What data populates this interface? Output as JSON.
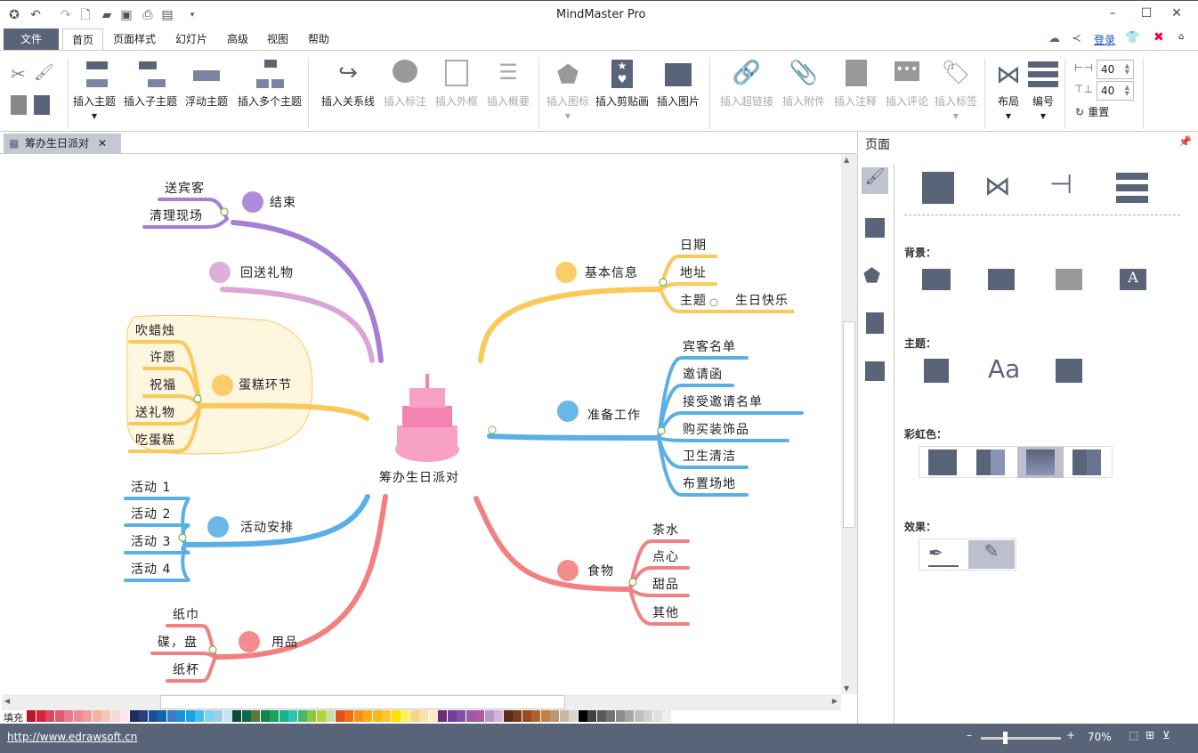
{
  "app": {
    "title": "MindMaster Pro"
  },
  "menu": {
    "file": "文件",
    "tabs": [
      "首页",
      "页面样式",
      "幻灯片",
      "高级",
      "视图",
      "帮助"
    ],
    "login": "登录"
  },
  "ribbon": {
    "insert_topic": "插入主题",
    "insert_subtopic": "插入子主题",
    "floating_topic": "浮动主题",
    "insert_multiple": "插入多个主题",
    "insert_relation": "插入关系线",
    "insert_callout": "插入标注",
    "insert_boundary": "插入外框",
    "insert_summary": "插入概要",
    "insert_icon": "插入图标",
    "insert_clipart": "插入剪贴画",
    "insert_image": "插入图片",
    "insert_hyperlink": "插入超链接",
    "insert_attachment": "插入附件",
    "insert_note": "插入注释",
    "insert_comment": "插入评论",
    "insert_tag": "插入标签",
    "layout": "布局",
    "numbering": "编号",
    "spacing_h": "40",
    "spacing_v": "40",
    "reset": "重置"
  },
  "doc_tab": {
    "title": "筹办生日派对"
  },
  "panel": {
    "title": "页面",
    "background": "背景：",
    "theme": "主题：",
    "rainbow": "彩虹色：",
    "effect": "效果："
  },
  "status": {
    "url": "http://www.edrawsoft.cn",
    "zoom": "70%",
    "zoom_level": 0.3
  },
  "palette": {
    "label": "填充",
    "colors": [
      "#c0122b",
      "#d6243a",
      "#d94860",
      "#e05a6e",
      "#e77b8a",
      "#ea8b97",
      "#f29b9b",
      "#f6b0a0",
      "#f7c6b7",
      "#f9d8d8",
      "#fde6ee",
      "#1f2d5c",
      "#2d3c80",
      "#1e4f9a",
      "#1264b3",
      "#3a7dc4",
      "#1c8fd6",
      "#16a4e6",
      "#40bff0",
      "#7dd3f5",
      "#a2cde8",
      "#c6e4f2",
      "#0e4a3a",
      "#0b6b4d",
      "#5a7a38",
      "#12844a",
      "#1aa05a",
      "#14b38a",
      "#2ac4b0",
      "#48b76c",
      "#8dc63f",
      "#b5d334",
      "#c4e0a6",
      "#e0531c",
      "#ef6c18",
      "#f7901e",
      "#fbab18",
      "#fdb913",
      "#fcc82f",
      "#ffe000",
      "#fff15b",
      "#f9d784",
      "#fbe0a8",
      "#fde9c7",
      "#6b2c7a",
      "#6f3f98",
      "#7f50a8",
      "#9a5aa6",
      "#b0589e",
      "#b896c8",
      "#d2b6d8",
      "#5c2a1a",
      "#7a3e1e",
      "#9a4a22",
      "#b26229",
      "#c57d42",
      "#b89774",
      "#c8b8a0",
      "#d8d8c8",
      "#000000",
      "#404040",
      "#595959",
      "#737373",
      "#8c8c8c",
      "#a6a6a6",
      "#bfbfbf",
      "#d0d0d0",
      "#e0e0e0",
      "#eeeeee"
    ]
  },
  "mindmap": {
    "central": "筹办生日派对",
    "branches": [
      {
        "label": "结束",
        "color": "#a57fd6",
        "children": [
          "送宾客",
          "清理现场"
        ]
      },
      {
        "label": "回送礼物",
        "color": "#dba6d6",
        "children": []
      },
      {
        "label": "蛋糕环节",
        "color": "#fbc85a",
        "children": [
          "吹蜡烛",
          "许愿",
          "祝福",
          "送礼物",
          "吃蛋糕"
        ]
      },
      {
        "label": "活动安排",
        "color": "#5aafe8",
        "children": [
          "活动 1",
          "活动 2",
          "活动 3",
          "活动 4"
        ]
      },
      {
        "label": "用品",
        "color": "#f28080",
        "children": [
          "纸巾",
          "碟，盘",
          "纸杯"
        ]
      },
      {
        "label": "基本信息",
        "color": "#fbc85a",
        "children": [
          "日期",
          "地址",
          "主题"
        ],
        "subchild": "生日快乐"
      },
      {
        "label": "准备工作",
        "color": "#5aafe8",
        "children": [
          "宾客名单",
          "邀请函",
          "接受邀请名单",
          "购买装饰品",
          "卫生清洁",
          "布置场地"
        ]
      },
      {
        "label": "食物",
        "color": "#f28080",
        "children": [
          "茶水",
          "点心",
          "甜品",
          "其他"
        ]
      }
    ]
  }
}
